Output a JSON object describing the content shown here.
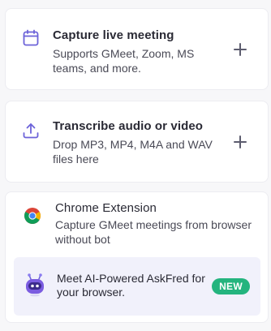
{
  "cards": [
    {
      "title": "Capture live meeting",
      "description": "Supports GMeet, Zoom, MS teams, and more.",
      "icon": "calendar-icon"
    },
    {
      "title": "Transcribe audio or video",
      "description": "Drop MP3, MP4, M4A and WAV files here",
      "icon": "upload-icon"
    }
  ],
  "extension": {
    "title": "Chrome Extension",
    "description": "Capture GMeet meetings from browser without bot",
    "icon": "chrome-icon",
    "promo": {
      "text": "Meet AI-Powered AskFred for your browser.",
      "badge": "NEW",
      "icon": "bot-icon"
    }
  },
  "colors": {
    "accent": "#6c63d9",
    "badge": "#24b47e",
    "promo_bg": "#f1f1fb"
  }
}
